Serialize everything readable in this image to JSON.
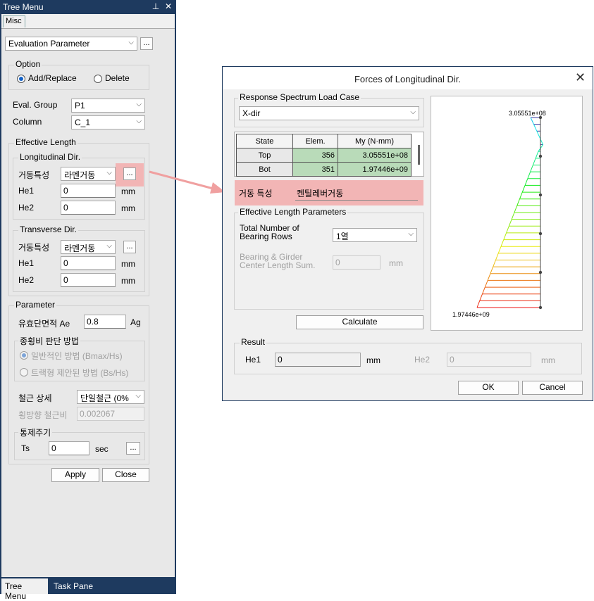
{
  "tree": {
    "title": "Tree Menu",
    "pin_icon": "pin-icon",
    "close_icon": "close-icon",
    "tab": "Misc",
    "eval_dropdown": "Evaluation Parameter",
    "option_label": "Option",
    "opt_add": "Add/Replace",
    "opt_delete": "Delete",
    "eval_group_label": "Eval. Group",
    "eval_group_value": "P1",
    "column_label": "Column",
    "column_value": "C_1",
    "eff_len_label": "Effective Length",
    "long_dir_label": "Longitudinal Dir.",
    "trans_dir_label": "Transverse Dir.",
    "geodong_label": "거동특성",
    "geodong_value": "라멘거동",
    "he1_label": "He1",
    "he2_label": "He2",
    "long_he1": "0",
    "long_he2": "0",
    "trans_he1": "0",
    "trans_he2": "0",
    "unit_mm": "mm",
    "dots": "...",
    "param_label": "Parameter",
    "ae_label": "유효단면적 Ae",
    "ae_value": "0.8",
    "ae_unit": "Ag",
    "ratio_label": "종횡비 판단 방법",
    "ratio_opt1": "일반적인 방법 (Bmax/Hs)",
    "ratio_opt2": "트랙형 제안된 방법 (Bs/Hs)",
    "rebar_label": "철근 상세",
    "rebar_value": "단일철근 (0%",
    "lat_rebar_label": "횡방향 철근비",
    "lat_rebar_value": "0.002067",
    "period_label": "통제주기",
    "ts_label": "Ts",
    "ts_value": "0",
    "ts_unit": "sec",
    "apply": "Apply",
    "close": "Close",
    "bottom_tab1": "Tree Menu",
    "bottom_tab2": "Task Pane"
  },
  "dialog": {
    "title": "Forces of Longitudinal Dir.",
    "rs_label": "Response Spectrum Load Case",
    "rs_value": "X-dir",
    "table_headers": [
      "State",
      "Elem.",
      "My (N·mm)"
    ],
    "table_rows": [
      [
        "Top",
        "356",
        "3.05551e+08"
      ],
      [
        "Bot",
        "351",
        "1.97446e+09"
      ]
    ],
    "geodong_label": "거동 특성",
    "geodong_value": "켄틸레버거동",
    "elp_label": "Effective Length Parameters",
    "rows_label_1": "Total Number of",
    "rows_label_2": "Bearing Rows",
    "rows_value": "1열",
    "bg_label_1": "Bearing & Girder",
    "bg_label_2": "Center Length Sum.",
    "bg_value": "0",
    "bg_unit": "mm",
    "calculate": "Calculate",
    "result_label": "Result",
    "he1_label": "He1",
    "he1_value": "0",
    "he1_unit": "mm",
    "he2_label": "He2",
    "he2_value": "0",
    "he2_unit": "mm",
    "ok": "OK",
    "cancel": "Cancel"
  },
  "chart_data": {
    "type": "area",
    "top_label": "3.05551e+08",
    "bottom_label": "1.97446e+09",
    "values_top_to_bottom": [
      305551000.0,
      1974460000.0
    ]
  },
  "colors": {
    "accent": "#1e3a5f",
    "highlight": "#f2b5b5",
    "table_green": "#b9dbb9",
    "arrow": "#f0a0a0"
  }
}
